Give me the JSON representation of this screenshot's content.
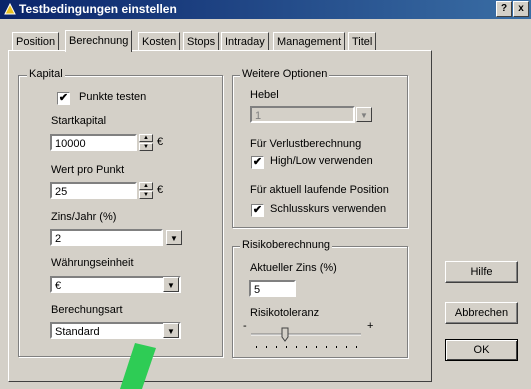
{
  "window": {
    "title": "Testbedingungen einstellen",
    "help_btn": "?",
    "close_btn": "x"
  },
  "tabs": [
    {
      "label": "Position"
    },
    {
      "label": "Berechnung"
    },
    {
      "label": "Kosten"
    },
    {
      "label": "Stops"
    },
    {
      "label": "Intraday"
    },
    {
      "label": "Management"
    },
    {
      "label": "Titel"
    }
  ],
  "kapital": {
    "title": "Kapital",
    "punkte_testen": {
      "label": "Punkte testen",
      "checked": "✔"
    },
    "startkapital": {
      "label": "Startkapital",
      "value": "10000",
      "unit": "€"
    },
    "wert_pro_punkt": {
      "label": "Wert pro Punkt",
      "value": "25",
      "unit": "€"
    },
    "zins": {
      "label": "Zins/Jahr (%)",
      "value": "2"
    },
    "waehrung": {
      "label": "Währungseinheit",
      "value": "€"
    },
    "berechnungsart": {
      "label": "Berechungsart",
      "value": "Standard"
    }
  },
  "weitere": {
    "title": "Weitere Optionen",
    "hebel": {
      "label": "Hebel",
      "value": "1"
    },
    "verlust": {
      "label": "Für Verlustberechnung",
      "checkbox": "High/Low verwenden",
      "checked": "✔"
    },
    "laufend": {
      "label": "Für aktuell laufende Position",
      "checkbox": "Schlusskurs verwenden",
      "checked": "✔"
    }
  },
  "risiko": {
    "title": "Risikoberechnung",
    "zins": {
      "label": "Aktueller Zins (%)",
      "value": "5"
    },
    "toleranz": {
      "label": "Risikotoleranz",
      "min": "-",
      "max": "+"
    }
  },
  "buttons": {
    "hilfe": "Hilfe",
    "abbrechen": "Abbrechen",
    "ok": "OK"
  },
  "colors": {
    "titlebar": "#0a246a",
    "face": "#d4d0c8",
    "arrow": "#2ecc55"
  }
}
